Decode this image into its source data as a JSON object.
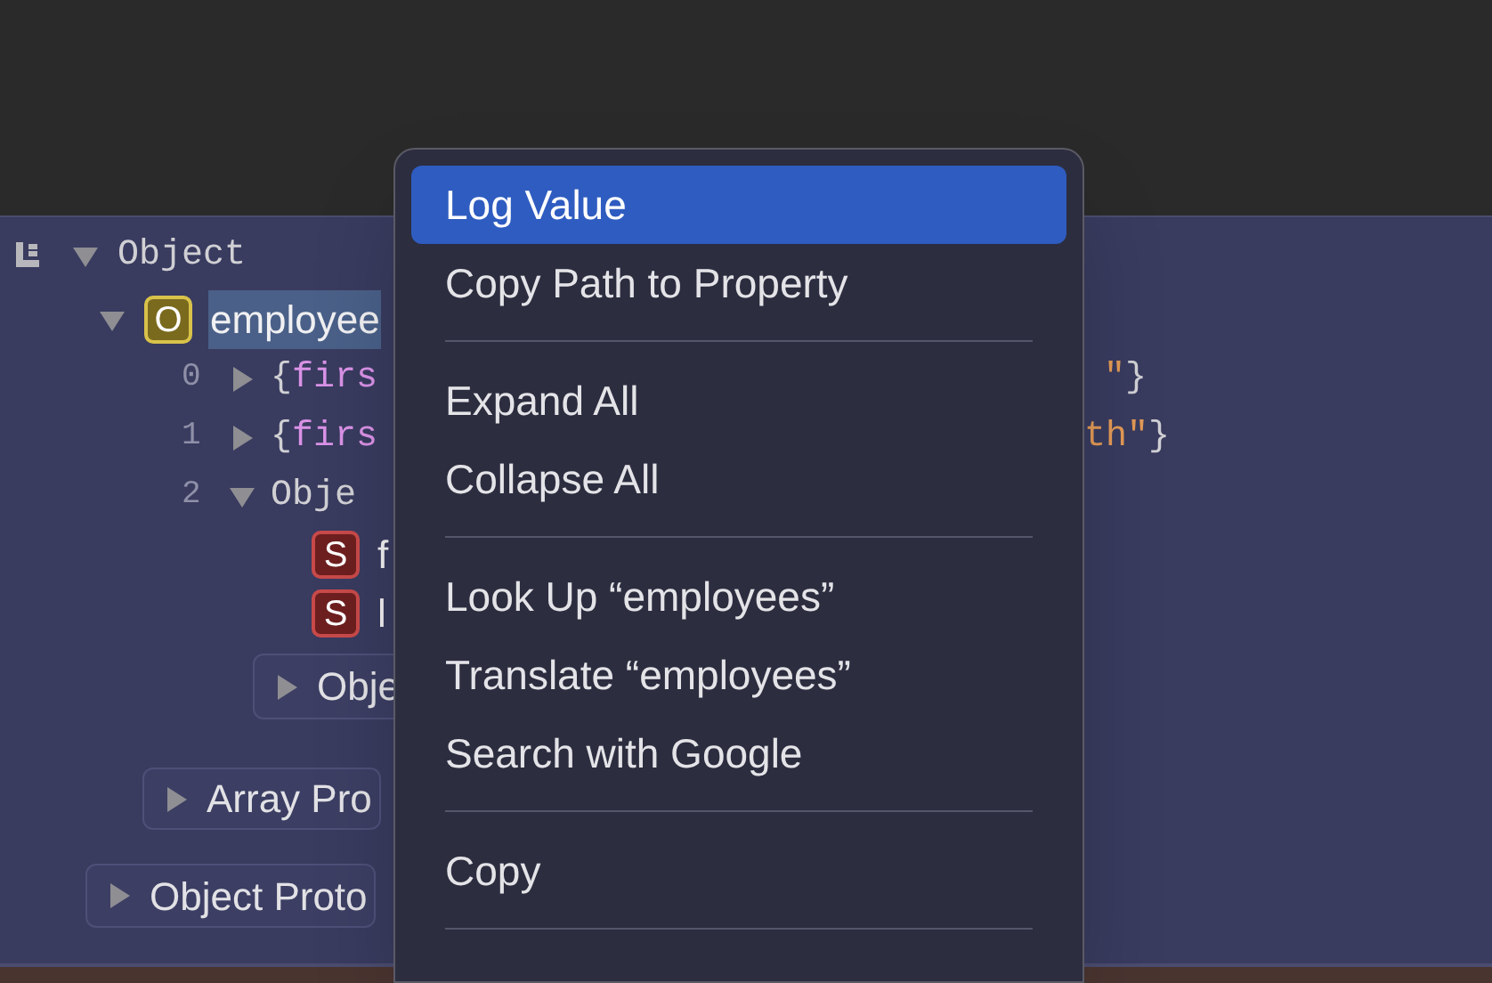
{
  "tree": {
    "label": "Object",
    "expanded": true,
    "children": [
      {
        "kind": "property",
        "badge": "O",
        "color": "#7a6a1e",
        "label": "employee",
        "selected": true,
        "expanded": true,
        "children": [
          {
            "kind": "index",
            "index": "0",
            "expanded": false,
            "open": "{",
            "key": "firs",
            "tail_value": "\"",
            "tail_close": "}"
          },
          {
            "kind": "index",
            "index": "1",
            "expanded": false,
            "open": "{",
            "key": "firs",
            "tail_value": "th\"",
            "tail_close": "}"
          },
          {
            "kind": "index",
            "index": "2",
            "expanded": true,
            "label": "Obje",
            "children": [
              {
                "kind": "property",
                "badge": "S",
                "color": "#6e1f1f",
                "label": "f",
                "selected": false
              },
              {
                "kind": "property",
                "badge": "S",
                "color": "#6e1f1f",
                "label": "l",
                "selected": false
              },
              {
                "kind": "prototype",
                "label": "Obje",
                "expanded": false
              }
            ]
          },
          {
            "kind": "prototype",
            "label": "Array Pro",
            "expanded": false
          }
        ]
      },
      {
        "kind": "prototype",
        "label": "Object Proto",
        "expanded": false
      }
    ]
  },
  "context_menu": {
    "groups": [
      [
        {
          "label": "Log Value",
          "selected": true
        },
        {
          "label": "Copy Path to Property",
          "selected": false
        }
      ],
      [
        {
          "label": "Expand All",
          "selected": false
        },
        {
          "label": "Collapse All",
          "selected": false
        }
      ],
      [
        {
          "label": "Look Up “employees”",
          "selected": false
        },
        {
          "label": "Translate “employees”",
          "selected": false
        },
        {
          "label": "Search with Google",
          "selected": false
        }
      ],
      [
        {
          "label": "Copy",
          "selected": false
        }
      ]
    ],
    "trailing_separator": true
  }
}
